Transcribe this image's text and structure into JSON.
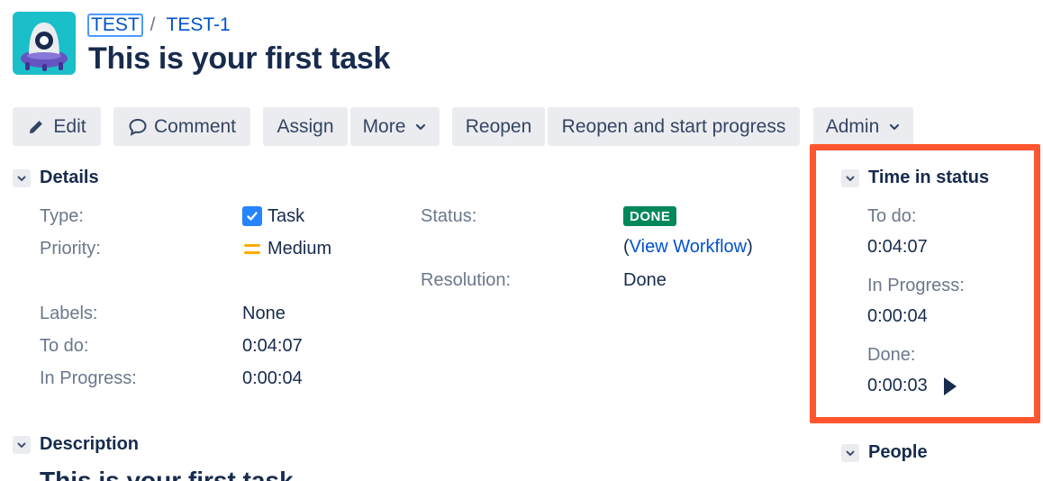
{
  "breadcrumb": {
    "project": "TEST",
    "separator": "/",
    "issue_key": "TEST-1"
  },
  "issue": {
    "title": "This is your first task"
  },
  "toolbar": {
    "edit": "Edit",
    "comment": "Comment",
    "assign": "Assign",
    "more": "More",
    "reopen": "Reopen",
    "reopen_start": "Reopen and start progress",
    "admin": "Admin"
  },
  "details": {
    "heading": "Details",
    "type_label": "Type:",
    "type_value": "Task",
    "priority_label": "Priority:",
    "priority_value": "Medium",
    "labels_label": "Labels:",
    "labels_value": "None",
    "todo_label": "To do:",
    "todo_value": "0:04:07",
    "inprogress_label": "In Progress:",
    "inprogress_value": "0:00:04",
    "status_label": "Status:",
    "status_value": "DONE",
    "workflow_open": "(",
    "workflow_link": "View Workflow",
    "workflow_close": ")",
    "resolution_label": "Resolution:",
    "resolution_value": "Done"
  },
  "time_in_status": {
    "heading": "Time in status",
    "todo_label": "To do:",
    "todo_value": "0:04:07",
    "inprogress_label": "In Progress:",
    "inprogress_value": "0:00:04",
    "done_label": "Done:",
    "done_value": "0:00:03"
  },
  "people": {
    "heading": "People"
  },
  "description": {
    "heading": "Description",
    "body": "This is your first task"
  },
  "colors": {
    "link": "#0052cc",
    "done_lozenge": "#00875a",
    "highlight": "#ff5630",
    "button_bg": "#ebecf0",
    "checkbox": "#2684ff",
    "priority": "#ffab00"
  },
  "icons": [
    "project-avatar",
    "pencil-icon",
    "comment-icon",
    "chevron-down-icon",
    "checkbox-icon",
    "priority-medium-icon",
    "play-icon"
  ]
}
